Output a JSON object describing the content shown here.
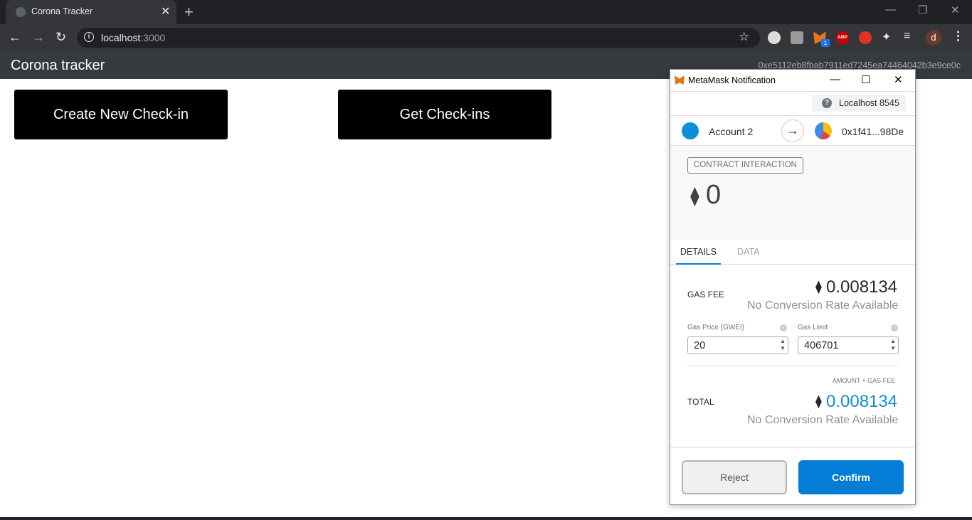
{
  "browser": {
    "tab_title": "Corona Tracker",
    "tab_close": "✕",
    "new_tab": "+",
    "url_host": "localhost",
    "url_port": ":3000",
    "extension_abp": "ABP",
    "extension_badge": "1",
    "profile_initial": "d"
  },
  "app": {
    "title": "Corona tracker",
    "account_address": "0xe5112eb8fbab7911ed7245ea74464042b3e9ce0c",
    "buttons": {
      "create": "Create New Check-in",
      "get": "Get Check-ins"
    }
  },
  "metamask": {
    "window_title": "MetaMask Notification",
    "network": "Localhost 8545",
    "from_account": "Account 2",
    "to_account": "0x1f41...98De",
    "interaction_type": "CONTRACT INTERACTION",
    "amount": "0",
    "tabs": {
      "details": "DETAILS",
      "data": "DATA"
    },
    "gas_fee": {
      "label": "GAS FEE",
      "value": "0.008134",
      "conversion": "No Conversion Rate Available"
    },
    "gas_price": {
      "label": "Gas Price (GWEI)",
      "value": "20"
    },
    "gas_limit": {
      "label": "Gas Limit",
      "value": "406701"
    },
    "total": {
      "sublabel": "AMOUNT + GAS FEE",
      "label": "TOTAL",
      "value": "0.008134",
      "conversion": "No Conversion Rate Available"
    },
    "buttons": {
      "reject": "Reject",
      "confirm": "Confirm"
    }
  },
  "colors": {
    "confirm": "#037dd6",
    "total_value": "#0d8fd0",
    "app_bar": "#343a40"
  }
}
